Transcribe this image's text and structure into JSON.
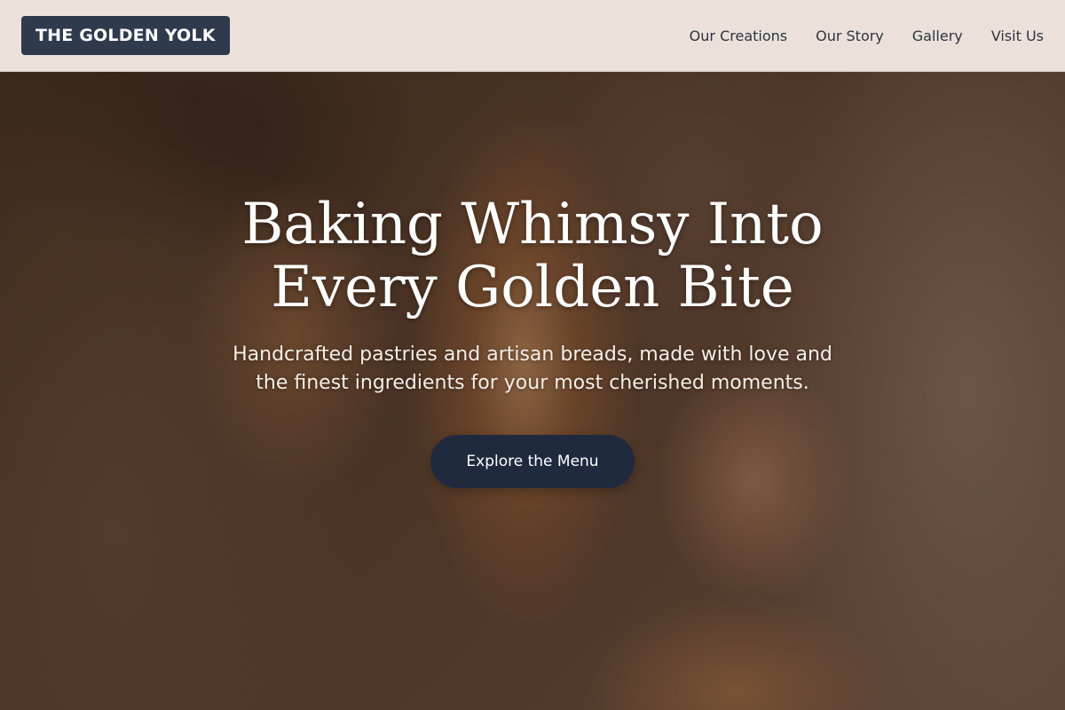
{
  "header": {
    "logo_text": "THE GOLDEN YOLK",
    "nav": [
      {
        "label": "Our Creations"
      },
      {
        "label": "Our Story"
      },
      {
        "label": "Gallery"
      },
      {
        "label": "Visit Us"
      }
    ]
  },
  "hero": {
    "title": "Baking Whimsy Into Every Golden Bite",
    "subtitle": "Handcrafted pastries and artisan breads, made with love and the finest ingredients for your most cherished moments.",
    "cta_label": "Explore the Menu"
  },
  "colors": {
    "header_bg": "#ece1da",
    "logo_bg": "#2f3a4c",
    "cta_bg": "#1f2a3f",
    "nav_text": "#2c3340"
  }
}
